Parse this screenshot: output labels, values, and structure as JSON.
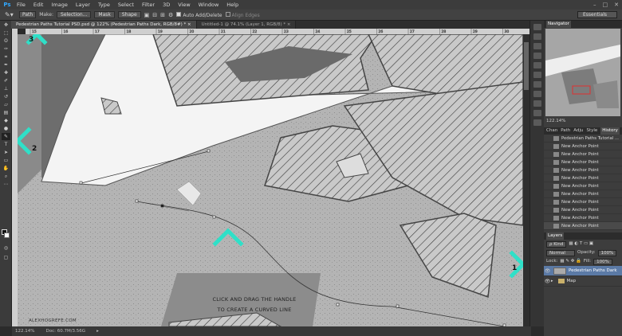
{
  "menubar": {
    "logo": "Ps",
    "items": [
      "File",
      "Edit",
      "Image",
      "Layer",
      "Type",
      "Select",
      "Filter",
      "3D",
      "View",
      "Window",
      "Help"
    ],
    "controls": [
      "–",
      "□",
      "✕"
    ]
  },
  "options": {
    "mode": "Path",
    "make_label": "Make:",
    "selection_btn": "Selection...",
    "mask_btn": "Mask",
    "shape_btn": "Shape",
    "auto_add": "Auto Add/Delete",
    "align_edges": "Align Edges",
    "workspace": "Essentials"
  },
  "tabs": [
    {
      "label": "Pedestrian Paths Tutorial PSD.psd @ 122% (Pedestrian Paths Dark, RGB/8#) *  ×"
    },
    {
      "label": "Untitled-1 @ 74.1% (Layer 1, RGB/8) *  ×"
    }
  ],
  "ruler": {
    "ticks": [
      "15",
      "16",
      "17",
      "18",
      "19",
      "20",
      "21",
      "22",
      "23",
      "24",
      "25",
      "26",
      "27",
      "28",
      "29",
      "30"
    ]
  },
  "canvas": {
    "caption_line1": "CLICK AND DRAG THE HANDLE",
    "caption_line2": "TO CREATE A CURVED LINE",
    "watermark": "ALEXHOGREFE.COM",
    "annot1": "1",
    "annot2": "2",
    "annot3": "3",
    "accent": "#2fe0c8"
  },
  "status": {
    "zoom": "122.14%",
    "doc": "Doc: 60.7M/3.56G"
  },
  "navigator": {
    "title": "Navigator",
    "zoom": "122.14%"
  },
  "history": {
    "tabs": [
      "Chan",
      "Path",
      "Adju",
      "Style",
      "History"
    ],
    "items": [
      "Pedestrian Paths Tutorial ...",
      "New Anchor Point",
      "New Anchor Point",
      "New Anchor Point",
      "New Anchor Point",
      "New Anchor Point",
      "New Anchor Point",
      "New Anchor Point",
      "New Anchor Point",
      "New Anchor Point",
      "New Anchor Point",
      "New Anchor Point"
    ]
  },
  "layers": {
    "title": "Layers",
    "kind": "ρ Kind",
    "blend": "Normal",
    "opacity_label": "Opacity:",
    "opacity": "100%",
    "lock_label": "Lock:",
    "fill_label": "Fill:",
    "fill": "100%",
    "items": [
      {
        "name": "Pedestrian Paths Dark"
      },
      {
        "name": "Map"
      }
    ]
  }
}
